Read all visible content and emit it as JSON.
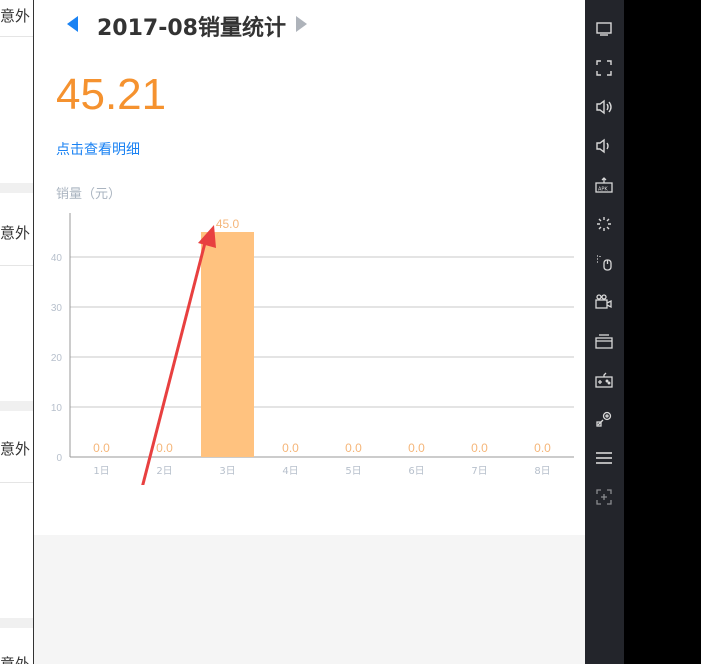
{
  "left_list": {
    "items": [
      {
        "label": "意外"
      },
      {
        "label": "意外"
      },
      {
        "label": "意外"
      },
      {
        "label": "意外"
      }
    ]
  },
  "header": {
    "title": "2017-08销量统计"
  },
  "summary": {
    "value": "45.21",
    "detail_link": "点击查看明细",
    "unit_label": "销量（元）"
  },
  "chart_data": {
    "type": "bar",
    "categories": [
      "1日",
      "2日",
      "3日",
      "4日",
      "5日",
      "6日",
      "7日",
      "8日"
    ],
    "values": [
      0.0,
      0.0,
      45.0,
      0.0,
      0.0,
      0.0,
      0.0,
      0.0
    ],
    "data_labels": [
      "0.0",
      "0.0",
      "45.0",
      "0.0",
      "0.0",
      "0.0",
      "0.0",
      "0.0"
    ],
    "ylim": [
      0,
      50
    ],
    "yticks": [
      "0",
      "10",
      "20",
      "30",
      "40"
    ],
    "grid": true,
    "bar_color": "#ffc27f",
    "label_color": "#f5b67a"
  },
  "annotation": {
    "type": "red-arrow",
    "color": "#e84040"
  },
  "toolbar": {
    "icons": [
      "window-icon",
      "fullscreen-icon",
      "volume-up-icon",
      "volume-down-icon",
      "apk-install-icon",
      "loading-icon",
      "mouse-icon",
      "video-camera-icon",
      "screenshot-icon",
      "gamepad-icon",
      "location-icon",
      "menu-icon",
      "add-icon"
    ]
  }
}
